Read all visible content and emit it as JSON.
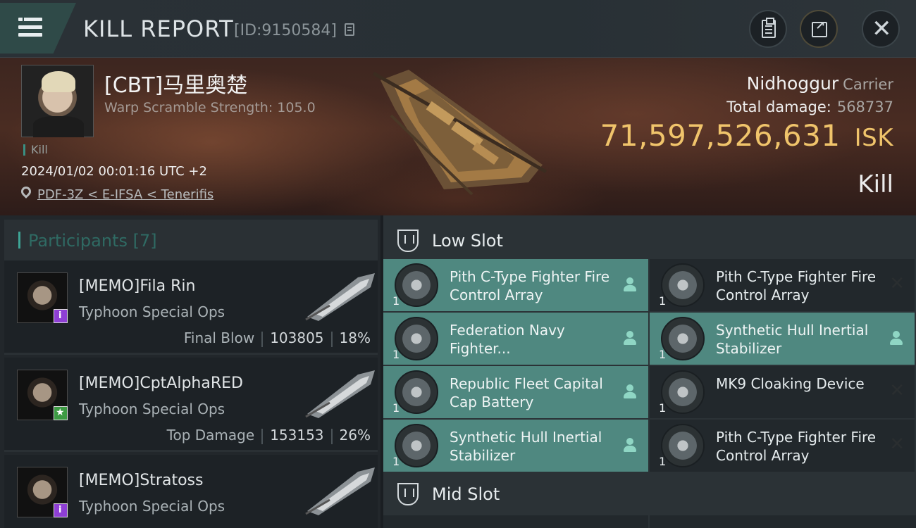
{
  "header": {
    "title": "KILL REPORT",
    "kill_id": "[ID:9150584]"
  },
  "victim": {
    "name": "[CBT]马里奥楚",
    "warp_scramble": "Warp Scramble Strength: 105.0",
    "tag": "Kill",
    "time": "2024/01/02 00:01:16 UTC +2",
    "location": "PDF-3Z < E-IFSA < Tenerifis"
  },
  "ship": {
    "name": "Nidhoggur",
    "class": "Carrier",
    "total_damage_label": "Total damage:",
    "total_damage_value": "568737",
    "isk_value": "71,597,526,631",
    "isk_unit": "ISK",
    "result": "Kill"
  },
  "participants": {
    "label": "Participants [7]",
    "rows": [
      {
        "name": "[MEMO]Fila Rin",
        "ship": "Typhoon Special Ops",
        "role": "Final Blow",
        "damage": "103805",
        "percent": "18%"
      },
      {
        "name": "[MEMO]CptAlphaRED",
        "ship": "Typhoon Special Ops",
        "role": "Top Damage",
        "damage": "153153",
        "percent": "26%"
      },
      {
        "name": "[MEMO]Stratoss",
        "ship": "Typhoon Special Ops",
        "role": "",
        "damage": "",
        "percent": ""
      }
    ]
  },
  "fitting": {
    "low_slot_title": "Low Slot",
    "mid_slot_title": "Mid Slot",
    "low_slot": [
      {
        "name": "Pith C-Type Fighter Fire Control Array",
        "qty": "1",
        "state": "dropped"
      },
      {
        "name": "Pith C-Type Fighter Fire Control Array",
        "qty": "1",
        "state": "destroyed"
      },
      {
        "name": "Federation Navy Fighter...",
        "qty": "1",
        "state": "dropped"
      },
      {
        "name": "Synthetic Hull Inertial Stabilizer",
        "qty": "1",
        "state": "dropped"
      },
      {
        "name": "Republic Fleet Capital Cap Battery",
        "qty": "1",
        "state": "dropped"
      },
      {
        "name": "MK9 Cloaking Device",
        "qty": "1",
        "state": "destroyed"
      },
      {
        "name": "Synthetic Hull Inertial Stabilizer",
        "qty": "1",
        "state": "dropped"
      },
      {
        "name": "Pith C-Type Fighter Fire Control Array",
        "qty": "1",
        "state": "destroyed"
      }
    ]
  },
  "colors": {
    "accent_teal": "#4f8880",
    "isk_gold": "#f0c46b"
  }
}
